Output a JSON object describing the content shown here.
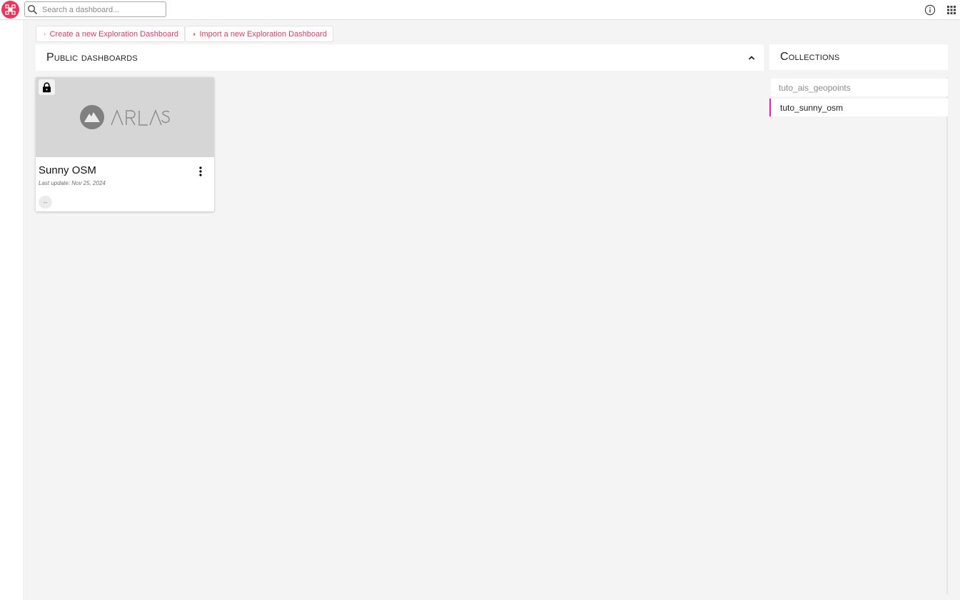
{
  "topbar": {
    "logo_icon": "network-nodes-icon",
    "search": {
      "placeholder": "Search a dashboard...",
      "value": ""
    },
    "info_icon": "info-icon",
    "apps_icon": "apps-grid-icon"
  },
  "actions": {
    "create_label": "Create a new Exploration Dashboard",
    "create_icon": "plus-icon",
    "import_label": "Import a new Exploration Dashboard",
    "import_icon": "upload-icon"
  },
  "public_section": {
    "title": "Public dashboards",
    "collapse_icon": "chevron-up-icon"
  },
  "dashboards": [
    {
      "thumbnail_brand": "ARLAS",
      "lock_icon": "lock-icon",
      "title": "Sunny OSM",
      "last_update": "Last update: Nov 25, 2024",
      "menu_icon": "more-vert-icon",
      "chip": "--"
    }
  ],
  "collections": {
    "title": "Collections",
    "items": [
      {
        "label": "tuto_ais_geopoints",
        "active": false
      },
      {
        "label": "tuto_sunny_osm",
        "active": true
      }
    ]
  },
  "colors": {
    "accent": "#e8375f",
    "active_collection": "#e91ebf",
    "background": "#f4f4f4"
  }
}
